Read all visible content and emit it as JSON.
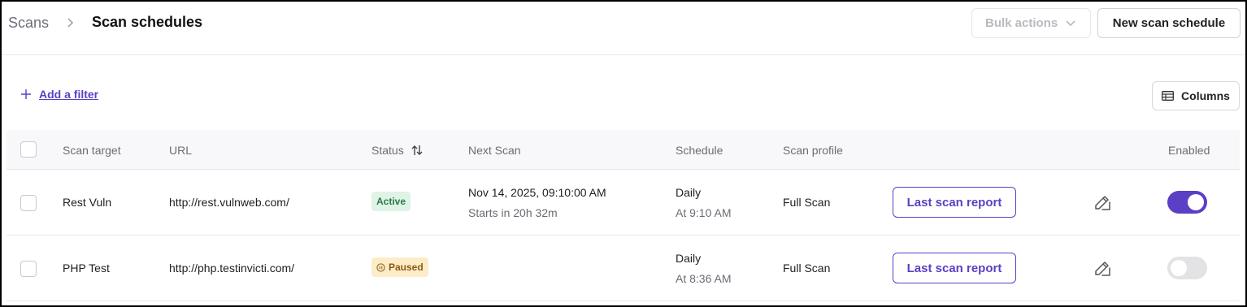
{
  "breadcrumb": {
    "parent": "Scans",
    "current": "Scan schedules"
  },
  "header_actions": {
    "bulk_actions": "Bulk actions",
    "new_schedule": "New scan schedule"
  },
  "toolbar": {
    "add_filter": "Add a filter",
    "columns": "Columns"
  },
  "table": {
    "headers": {
      "scan_target": "Scan target",
      "url": "URL",
      "status": "Status",
      "next_scan": "Next Scan",
      "schedule": "Schedule",
      "scan_profile": "Scan profile",
      "enabled": "Enabled"
    },
    "rows": [
      {
        "scan_target": "Rest Vuln",
        "url": "http://rest.vulnweb.com/",
        "status": "Active",
        "next_scan": "Nov 14, 2025, 09:10:00 AM",
        "next_scan_sub": "Starts in 20h 32m",
        "schedule": "Daily",
        "schedule_time": "At 9:10 AM",
        "scan_profile": "Full Scan",
        "report_button": "Last scan report",
        "enabled": true
      },
      {
        "scan_target": "PHP Test",
        "url": "http://php.testinvicti.com/",
        "status": "Paused",
        "next_scan": "",
        "next_scan_sub": "",
        "schedule": "Daily",
        "schedule_time": "At 8:36 AM",
        "scan_profile": "Full Scan",
        "report_button": "Last scan report",
        "enabled": false
      }
    ]
  },
  "colors": {
    "accent": "#5b3fc4",
    "active_bg": "#dff3e6",
    "paused_bg": "#fdecc8"
  }
}
